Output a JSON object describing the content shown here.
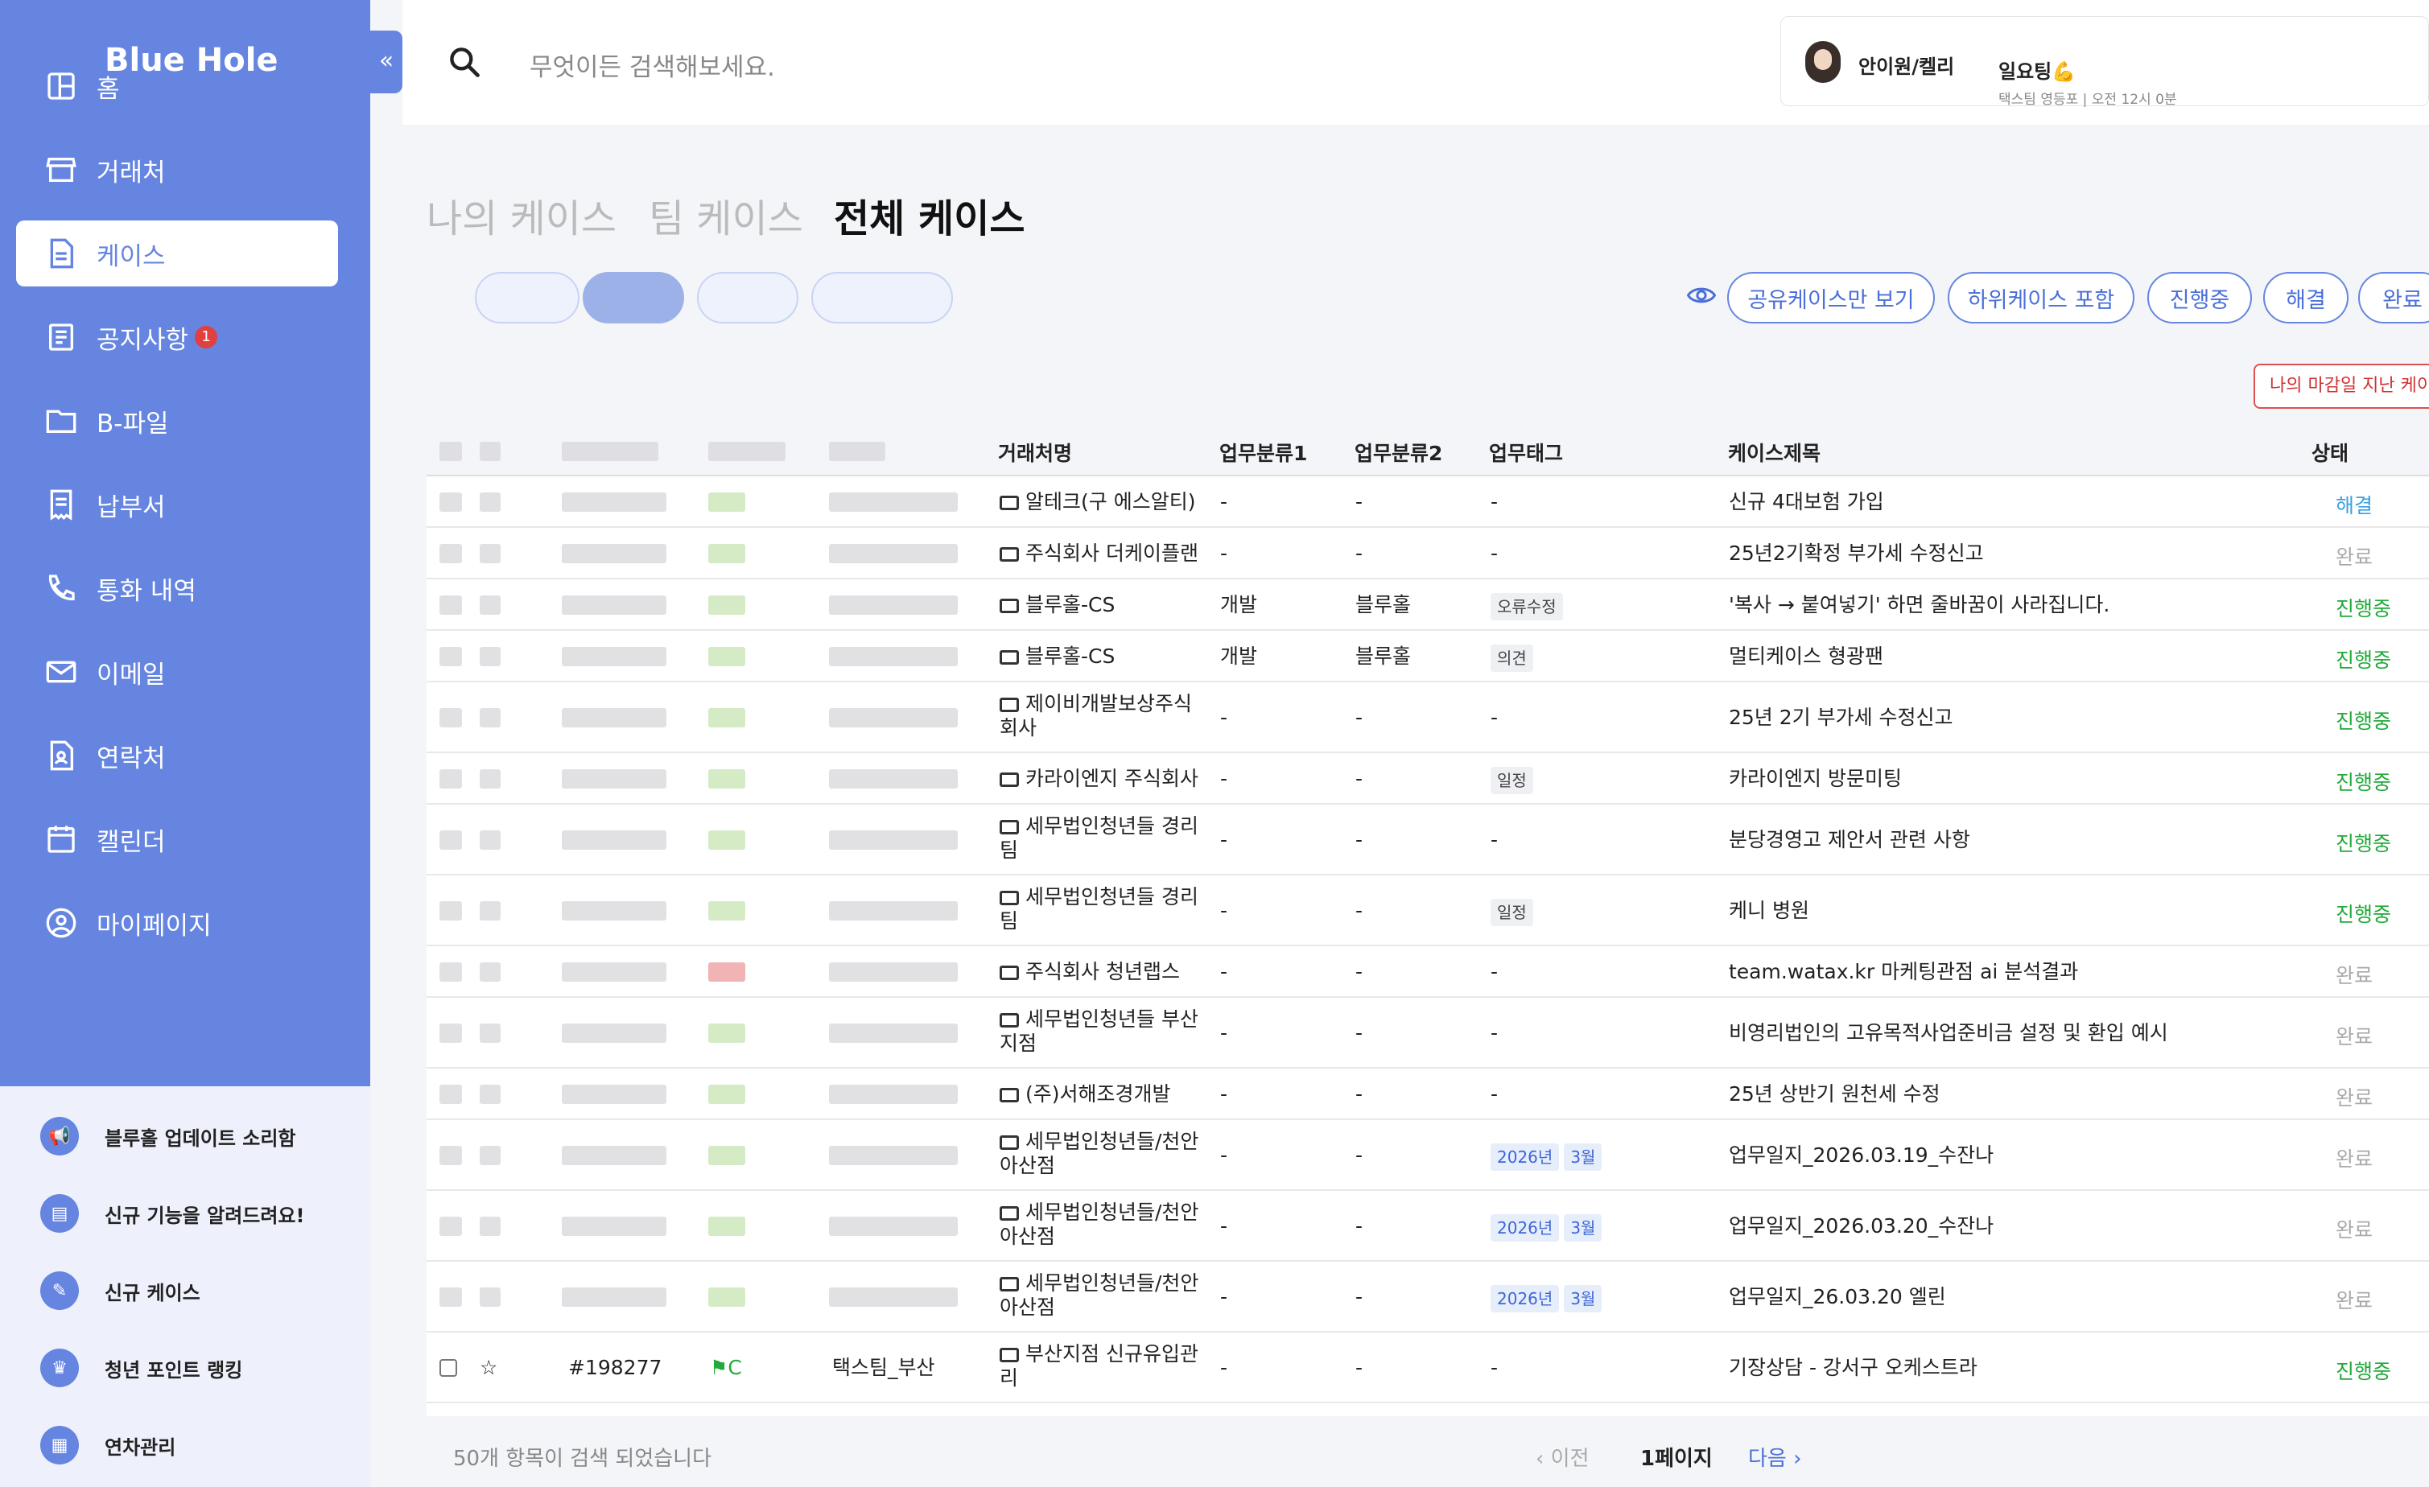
{
  "app": {
    "logo": "Blue Hole",
    "collapse": "«"
  },
  "sidebar": {
    "items": [
      {
        "label": "홈",
        "icon": "dashboard-icon"
      },
      {
        "label": "거래처",
        "icon": "store-icon"
      },
      {
        "label": "케이스",
        "icon": "document-icon",
        "active": true
      },
      {
        "label": "공지사항",
        "icon": "notice-icon",
        "badge": "1"
      },
      {
        "label": "B-파일",
        "icon": "folder-icon"
      },
      {
        "label": "납부서",
        "icon": "receipt-icon"
      },
      {
        "label": "통화 내역",
        "icon": "phone-icon"
      },
      {
        "label": "이메일",
        "icon": "mail-icon"
      },
      {
        "label": "연락처",
        "icon": "contact-icon"
      },
      {
        "label": "캘린더",
        "icon": "calendar-icon"
      },
      {
        "label": "마이페이지",
        "icon": "user-circle-icon"
      }
    ],
    "bottom": [
      {
        "label": "블루홀 업데이트 소리함",
        "icon": "megaphone-icon"
      },
      {
        "label": "신규 기능을 알려드려요!",
        "icon": "news-icon"
      },
      {
        "label": "신규 케이스",
        "icon": "new-case-icon"
      },
      {
        "label": "청년 포인트 랭킹",
        "icon": "crown-icon"
      },
      {
        "label": "연차관리",
        "icon": "calendar-check-icon"
      }
    ]
  },
  "search": {
    "placeholder": "무엇이든 검색해보세요."
  },
  "user": {
    "name": "안이원/켈리",
    "status_title": "일요팅💪",
    "status_sub": "택스팀 영등포 | 오전 12시 0분"
  },
  "tabs": [
    {
      "label": "나의 케이스",
      "active": false
    },
    {
      "label": "팀 케이스",
      "active": false
    },
    {
      "label": "전체 케이스",
      "active": true
    }
  ],
  "filters": [
    "공유케이스만 보기",
    "하위케이스 포함",
    "진행중",
    "해결",
    "완료"
  ],
  "overdue_button": "나의 마감일 지난 케이스",
  "table": {
    "headers": [
      "거래처명",
      "업무분류1",
      "업무분류2",
      "업무태그",
      "케이스제목",
      "상태"
    ],
    "rows": [
      {
        "client": "알테크(구 에스알티)",
        "cat1": "-",
        "cat2": "-",
        "tags": [],
        "tag_text": "-",
        "title": "신규 4대보험 가입",
        "status": "해결",
        "status_kind": "res"
      },
      {
        "client": "주식회사 더케이플랜",
        "cat1": "-",
        "cat2": "-",
        "tags": [],
        "tag_text": "-",
        "title": "25년2기확정 부가세 수정신고",
        "status": "완료",
        "status_kind": "done"
      },
      {
        "client": "블루홀-CS",
        "cat1": "개발",
        "cat2": "블루홀",
        "tags": [
          "오류수정"
        ],
        "tag_text": "",
        "title": "'복사 → 붙여넣기' 하면 줄바꿈이 사라집니다.",
        "status": "진행중",
        "status_kind": "prog"
      },
      {
        "client": "블루홀-CS",
        "cat1": "개발",
        "cat2": "블루홀",
        "tags": [
          "의견"
        ],
        "tag_text": "",
        "title": "멀티케이스 형광팬",
        "status": "진행중",
        "status_kind": "prog"
      },
      {
        "client": "제이비개발보상주식회사",
        "cat1": "-",
        "cat2": "-",
        "tags": [],
        "tag_text": "-",
        "title": "25년 2기 부가세 수정신고",
        "status": "진행중",
        "status_kind": "prog"
      },
      {
        "client": "카라이엔지 주식회사",
        "cat1": "-",
        "cat2": "-",
        "tags": [
          "일정"
        ],
        "tag_text": "",
        "title": "카라이엔지 방문미팅",
        "status": "진행중",
        "status_kind": "prog"
      },
      {
        "client": "세무법인청년들 경리팀",
        "cat1": "-",
        "cat2": "-",
        "tags": [],
        "tag_text": "-",
        "title": "분당경영고 제안서 관련 사항",
        "status": "진행중",
        "status_kind": "prog"
      },
      {
        "client": "세무법인청년들 경리팀",
        "cat1": "-",
        "cat2": "-",
        "tags": [
          "일정"
        ],
        "tag_text": "",
        "title": "케니 병원",
        "status": "진행중",
        "status_kind": "prog"
      },
      {
        "client": "주식회사 청년랩스",
        "cat1": "-",
        "cat2": "-",
        "tags": [],
        "tag_text": "-",
        "title": "team.watax.kr 마케팅관점 ai 분석결과",
        "status": "완료",
        "status_kind": "done"
      },
      {
        "client": "세무법인청년들 부산지점",
        "cat1": "-",
        "cat2": "-",
        "tags": [],
        "tag_text": "-",
        "title": "비영리법인의 고유목적사업준비금 설정 및 환입 예시",
        "status": "완료",
        "status_kind": "done"
      },
      {
        "client": "(주)서해조경개발",
        "cat1": "-",
        "cat2": "-",
        "tags": [],
        "tag_text": "-",
        "title": "25년 상반기 원천세 수정",
        "status": "완료",
        "status_kind": "done"
      },
      {
        "client": "세무법인청년들/천안아산점",
        "cat1": "-",
        "cat2": "-",
        "tags": [
          "2026년",
          "3월"
        ],
        "tag_text": "",
        "title": "업무일지_2026.03.19_수잔나",
        "status": "완료",
        "status_kind": "done"
      },
      {
        "client": "세무법인청년들/천안아산점",
        "cat1": "-",
        "cat2": "-",
        "tags": [
          "2026년",
          "3월"
        ],
        "tag_text": "",
        "title": "업무일지_2026.03.20_수잔나",
        "status": "완료",
        "status_kind": "done"
      },
      {
        "client": "세무법인청년들/천안아산점",
        "cat1": "-",
        "cat2": "-",
        "tags": [
          "2026년",
          "3월"
        ],
        "tag_text": "",
        "title": "업무일지_26.03.20 엘린",
        "status": "완료",
        "status_kind": "done"
      },
      {
        "client": "부산지점 신규유입관리",
        "cat1": "-",
        "cat2": "-",
        "tags": [],
        "tag_text": "-",
        "title": "기장상담 - 강서구 오케스트라",
        "status": "진행중",
        "status_kind": "prog",
        "case_no": "#198277",
        "priority": "C",
        "team": "택스팀_부산"
      }
    ]
  },
  "footer": {
    "count": "50개 항목이 검색 되었습니다",
    "prev": "‹ 이전",
    "page": "1페이지",
    "next": "다음 ›"
  }
}
